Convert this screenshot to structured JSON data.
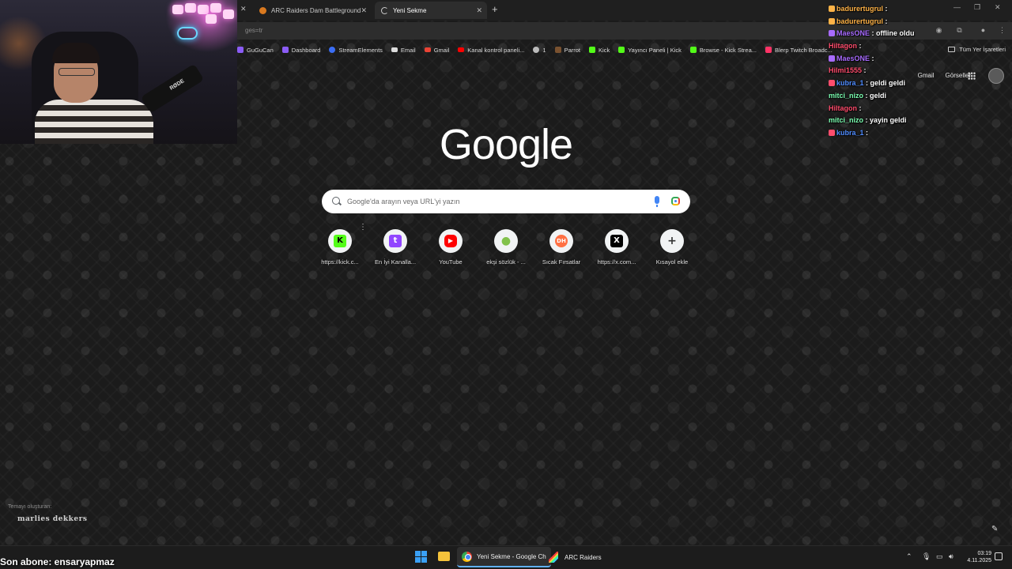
{
  "browser": {
    "tabs": [
      {
        "label": "ARC Raiders Dam Battleground"
      },
      {
        "label": "Yeni Sekme"
      }
    ],
    "url_fragment": "ges=tr",
    "bookmarks": [
      {
        "label": "GuGuCan",
        "color": "#8b5cf6"
      },
      {
        "label": "Dashboard",
        "color": "#8b5cf6"
      },
      {
        "label": "StreamElements",
        "color": "#3b6ef5"
      },
      {
        "label": "Email",
        "color": "#dddddd"
      },
      {
        "label": "Gmail",
        "color": "#ea4335"
      },
      {
        "label": "Kanal kontrol paneli...",
        "color": "#ff0000"
      },
      {
        "label": "1",
        "color": "#bbbbbb"
      },
      {
        "label": "Parrot",
        "color": "#7a5230"
      },
      {
        "label": "Kick",
        "color": "#53fc18"
      },
      {
        "label": "Yayıncı Paneli | Kick",
        "color": "#53fc18"
      },
      {
        "label": "Browse - Kick Strea...",
        "color": "#53fc18"
      },
      {
        "label": "Blerp Twitch Broadc...",
        "color": "#ff3366"
      }
    ],
    "all_bookmarks_label": "Tüm Yer İşaretleri"
  },
  "webcam": {
    "mic_brand": "RØDE"
  },
  "chat": [
    {
      "user": "badurertugrul",
      "user_color": "#ffb347",
      "msg": ""
    },
    {
      "user": "badurertugrul",
      "user_color": "#ffb347",
      "msg": ""
    },
    {
      "user": "MaesONE",
      "user_color": "#a86bff",
      "msg": "offline oldu"
    },
    {
      "user": "Hiltagon",
      "user_color": "#ff4d6d",
      "msg": ""
    },
    {
      "user": "MaesONE",
      "user_color": "#a86bff",
      "msg": ""
    },
    {
      "user": "Hilmi1555",
      "user_color": "#ff4d6d",
      "msg": ""
    },
    {
      "user": "kubra_1",
      "user_color": "#4f8cff",
      "msg": "geldi geldi"
    },
    {
      "user": "mitci_nizo",
      "user_color": "#7cffb2",
      "msg": "geldi"
    },
    {
      "user": "Hiltagon",
      "user_color": "#ff4d6d",
      "msg": ""
    },
    {
      "user": "mitci_nizo",
      "user_color": "#7cffb2",
      "msg": "yayin geldi"
    },
    {
      "user": "kubra_1",
      "user_color": "#4f8cff",
      "msg": ""
    }
  ],
  "google": {
    "header_links": [
      "Gmail",
      "Görseller"
    ],
    "logo": "Google",
    "search_placeholder": "Google'da arayın veya URL'yi yazın",
    "shortcuts": [
      {
        "label": "https://kick.c...",
        "icon": "kick-icon",
        "glyph": "K",
        "bg": "#53fc18",
        "fg": "#000000"
      },
      {
        "label": "En İyi Kanalla...",
        "icon": "twitch-icon",
        "glyph": "t",
        "bg": "#9146ff",
        "fg": "#ffffff"
      },
      {
        "label": "YouTube",
        "icon": "youtube-icon",
        "glyph": "▶",
        "bg": "#ff0000",
        "fg": "#ffffff"
      },
      {
        "label": "ekşi sözlük - ...",
        "icon": "eksi-icon",
        "glyph": "●",
        "bg": "#f1f3f4",
        "fg": "#81c14b"
      },
      {
        "label": "Sıcak Fırsatlar",
        "icon": "deals-icon",
        "glyph": "DH",
        "bg": "#ff7043",
        "fg": "#ffffff"
      },
      {
        "label": "https://x.com...",
        "icon": "x-icon",
        "glyph": "X",
        "bg": "#000000",
        "fg": "#ffffff"
      },
      {
        "label": "Kısayol ekle",
        "icon": "plus-icon",
        "glyph": "+",
        "bg": "#f1f3f4",
        "fg": "#333333"
      }
    ],
    "theme_credit_label": "Temayı oluşturan:",
    "theme_author": "marlies dekkers"
  },
  "overlay": {
    "last_subscriber": "Son abone: ensaryapmaz"
  },
  "taskbar": {
    "apps": [
      {
        "label": "Yeni Sekme - Google Ch",
        "icon": "chrome-icon"
      },
      {
        "label": "ARC Raiders",
        "icon": "arc-raiders-icon"
      }
    ],
    "time": "03:19",
    "date": "4.11.2025"
  }
}
